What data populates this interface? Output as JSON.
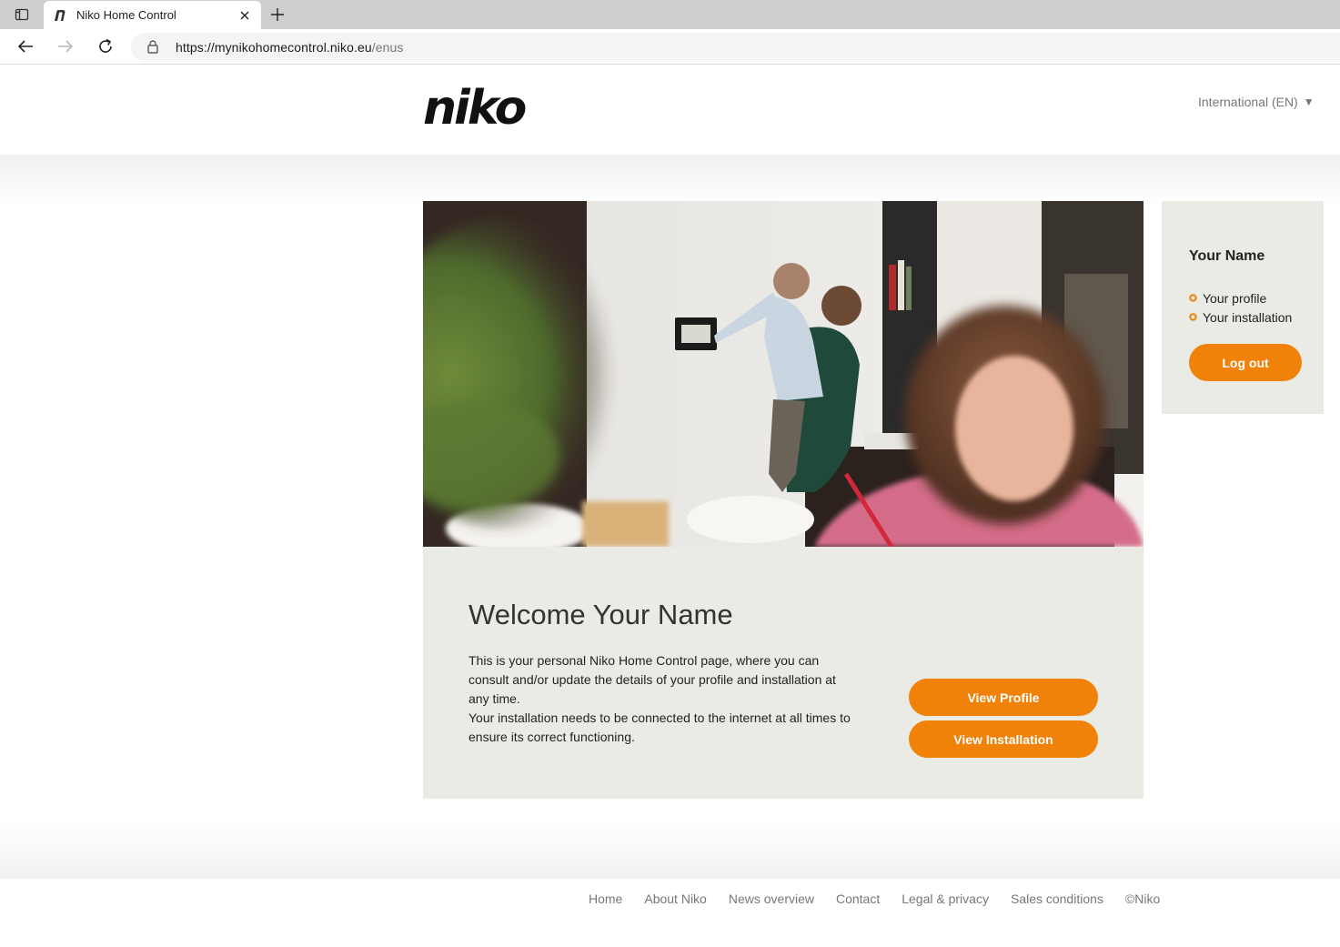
{
  "browser": {
    "tab_title": "Niko Home Control",
    "url_host": "https://mynikohomecontrol.niko.eu",
    "url_path": "/enus"
  },
  "header": {
    "logo_text": "niko",
    "language": "International (EN)"
  },
  "welcome": {
    "title": "Welcome Your Name",
    "paragraph1": "This is your personal Niko Home Control page, where you can consult and/or update the details of your profile and installation at any time.",
    "paragraph2": "Your installation needs to be connected to the internet at all times to ensure its correct functioning.",
    "view_profile_label": "View Profile",
    "view_installation_label": "View Installation"
  },
  "sidebar": {
    "name": "Your Name",
    "links": [
      {
        "label": "Your profile"
      },
      {
        "label": "Your installation"
      }
    ],
    "logout_label": "Log out"
  },
  "footer": {
    "links": [
      {
        "label": "Home"
      },
      {
        "label": "About Niko"
      },
      {
        "label": "News overview"
      },
      {
        "label": "Contact"
      },
      {
        "label": "Legal & privacy"
      },
      {
        "label": "Sales conditions"
      }
    ],
    "copyright": "©Niko"
  },
  "colors": {
    "accent": "#f0820a",
    "panel": "#ebebe6",
    "muted_text": "#777777"
  },
  "icons": {
    "tab_actions": "tab-actions-icon",
    "favicon": "niko-favicon-icon",
    "close": "close-icon",
    "new_tab": "plus-icon",
    "back": "back-arrow-icon",
    "forward": "forward-arrow-icon",
    "reload": "reload-icon",
    "lock": "lock-icon",
    "bullet": "circle-bullet-icon",
    "language_caret": "caret-down-icon"
  }
}
